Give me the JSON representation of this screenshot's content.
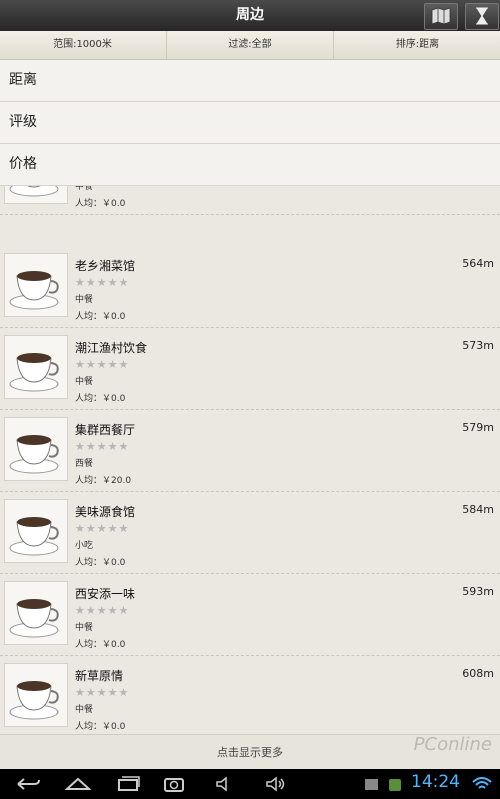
{
  "header": {
    "title": "周边"
  },
  "filters": {
    "range": "范围:1000米",
    "filter": "过滤:全部",
    "sort": "排序:距离"
  },
  "sort_menu": {
    "items": [
      "距离",
      "评级",
      "价格"
    ]
  },
  "restaurants": [
    {
      "name": "",
      "category": "中餐",
      "price": "人均：￥0.0",
      "distance": ""
    },
    {
      "name": "老乡湘菜馆",
      "category": "中餐",
      "price": "人均：￥0.0",
      "distance": "564m"
    },
    {
      "name": "潮江渔村饮食",
      "category": "中餐",
      "price": "人均：￥0.0",
      "distance": "573m"
    },
    {
      "name": "集群西餐厅",
      "category": "西餐",
      "price": "人均：￥20.0",
      "distance": "579m"
    },
    {
      "name": "美味源食馆",
      "category": "小吃",
      "price": "人均：￥0.0",
      "distance": "584m"
    },
    {
      "name": "西安添一味",
      "category": "中餐",
      "price": "人均：￥0.0",
      "distance": "593m"
    },
    {
      "name": "新草原情",
      "category": "中餐",
      "price": "人均：￥0.0",
      "distance": "608m"
    }
  ],
  "stars_text": "★★★★★",
  "load_more": "点击显示更多",
  "system": {
    "clock": "14:24"
  },
  "watermark": "PConline"
}
